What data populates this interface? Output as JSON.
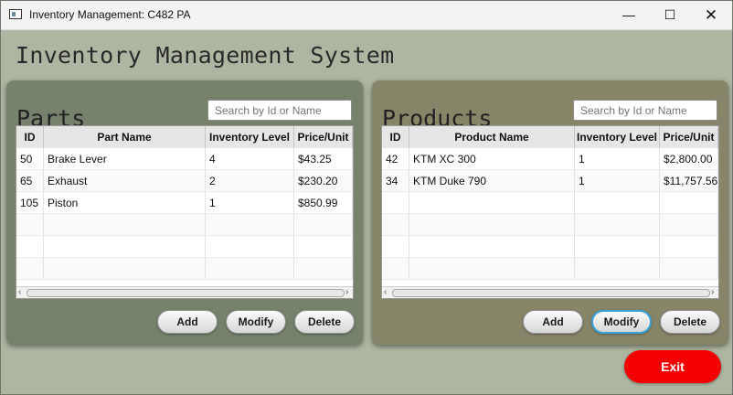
{
  "window": {
    "title": "Inventory Management: C482 PA",
    "controls": {
      "minimize": "—",
      "maximize": "☐",
      "close": "✕"
    }
  },
  "app_title": "Inventory Management System",
  "parts": {
    "title": "Parts",
    "search_placeholder": "Search by Id or Name",
    "columns": [
      "ID",
      "Part Name",
      "Inventory   Level",
      "Price/Unit"
    ],
    "rows": [
      [
        "50",
        "Brake Lever",
        "4",
        "$43.25"
      ],
      [
        "65",
        "Exhaust",
        "2",
        "$230.20"
      ],
      [
        "105",
        "Piston",
        "1",
        "$850.99"
      ]
    ],
    "buttons": {
      "add": "Add",
      "modify": "Modify",
      "delete": "Delete"
    }
  },
  "products": {
    "title": "Products",
    "search_placeholder": "Search by Id or Name",
    "columns": [
      "ID",
      "Product Name",
      "Inventory Level",
      "Price/Unit"
    ],
    "rows": [
      [
        "42",
        "KTM XC 300",
        "1",
        "$2,800.00"
      ],
      [
        "34",
        "KTM Duke 790",
        "1",
        "$11,757.56"
      ]
    ],
    "buttons": {
      "add": "Add",
      "modify": "Modify",
      "delete": "Delete"
    }
  },
  "exit_label": "Exit",
  "scroll": {
    "left": "‹",
    "right": "›"
  },
  "colors": {
    "exit": "#f40000",
    "focus": "#3aa0d8",
    "parts_panel": "#76826c",
    "products_panel": "#878568"
  }
}
